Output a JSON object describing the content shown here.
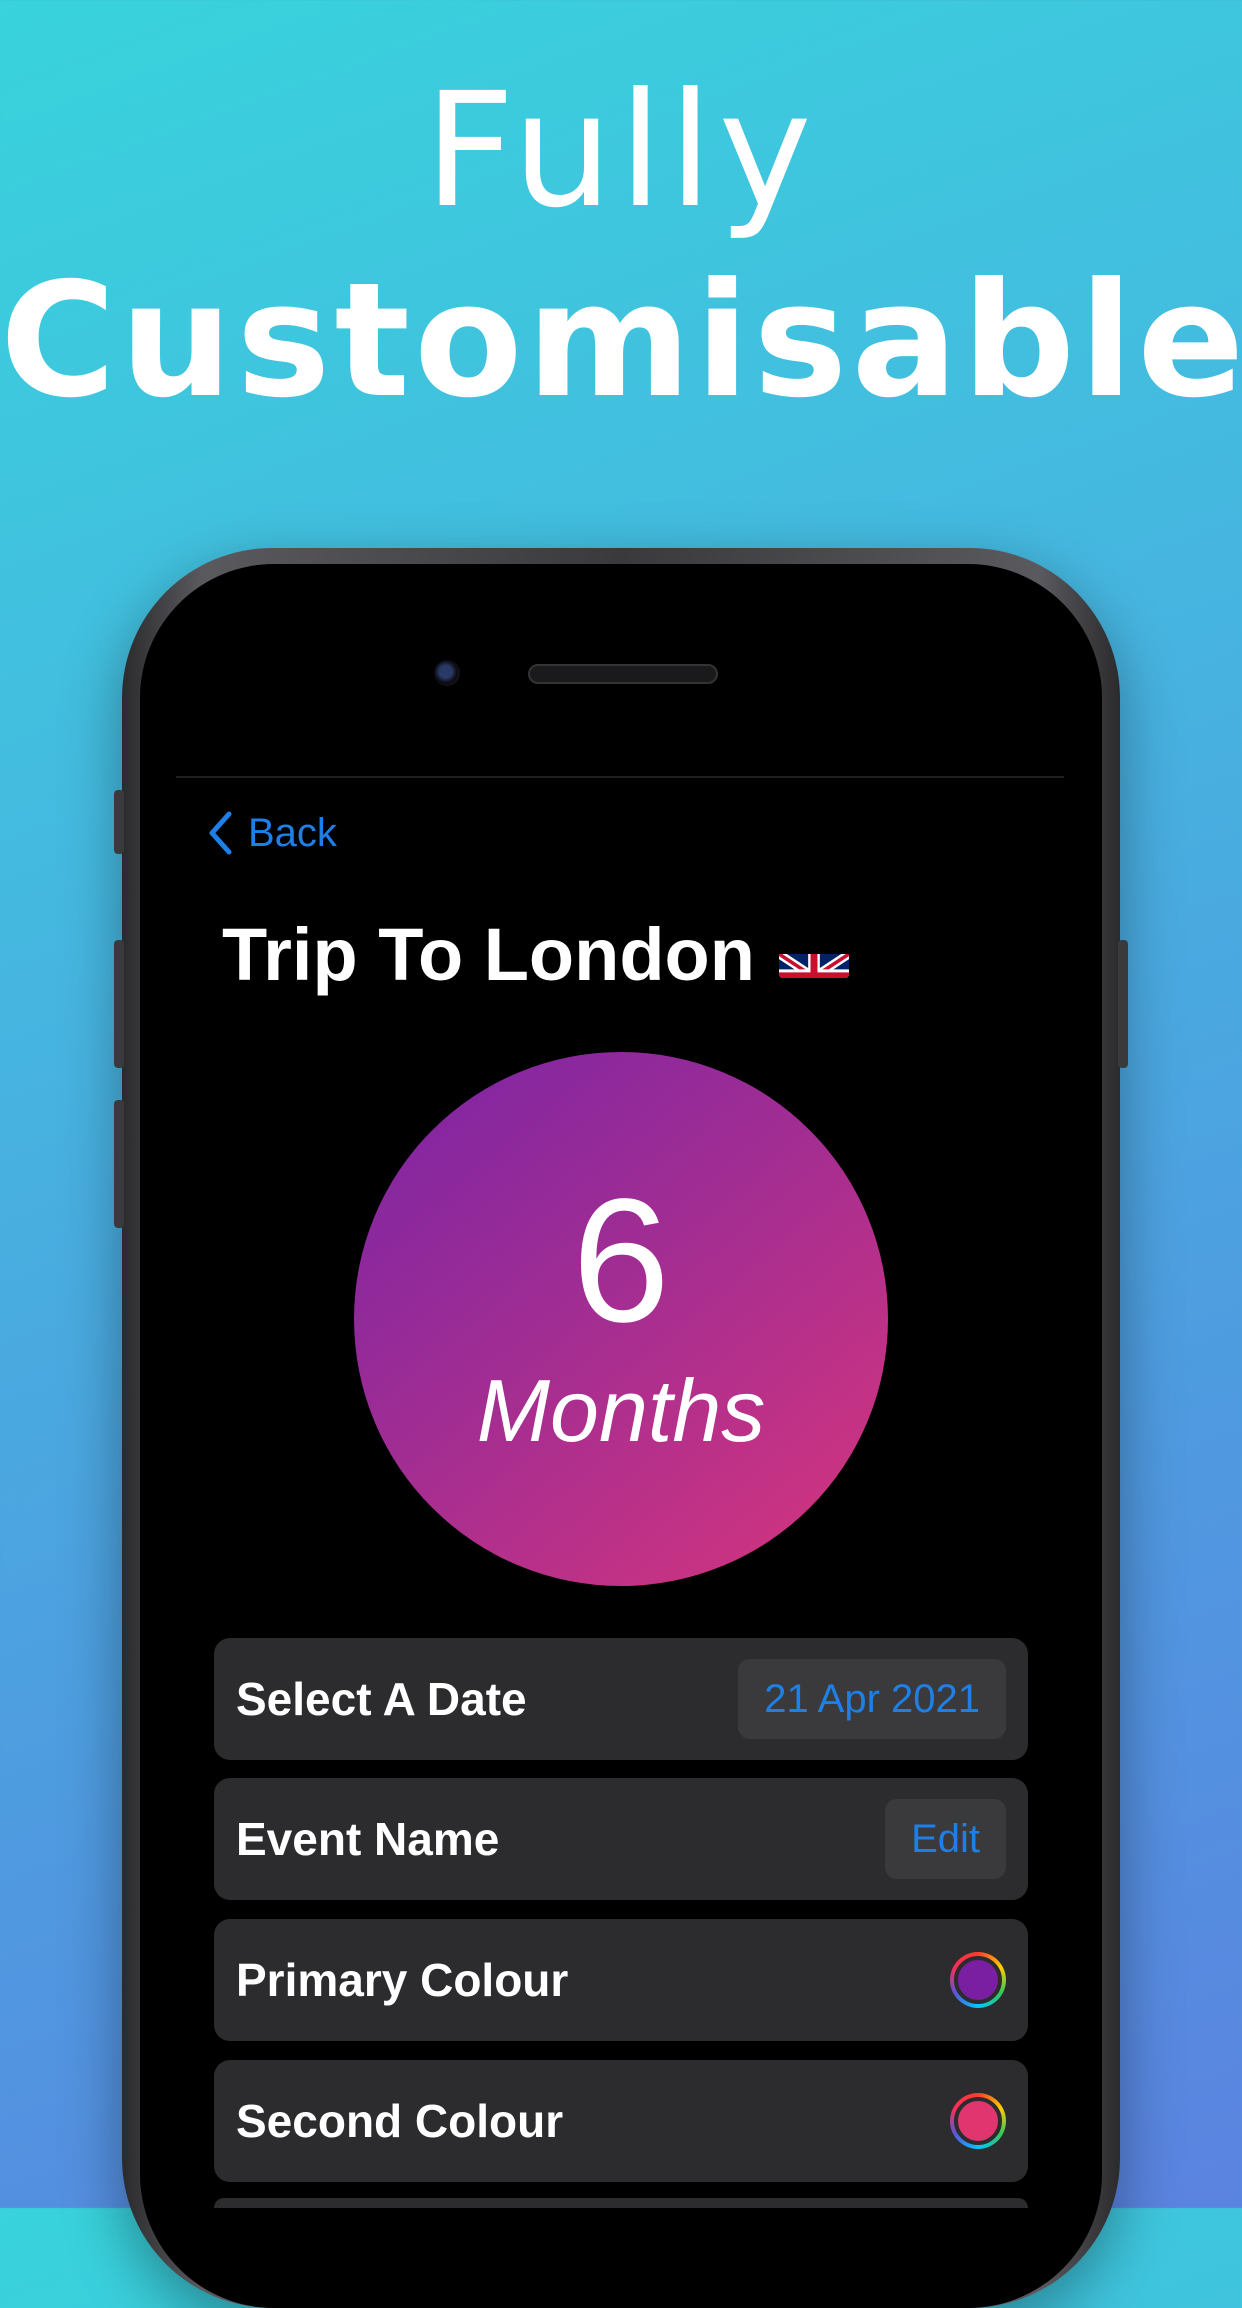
{
  "headline": {
    "line1": "Fully",
    "line2": "Customisable"
  },
  "nav": {
    "back_label": "Back"
  },
  "event": {
    "title": "Trip To London",
    "flag_icon": "uk-flag-icon"
  },
  "countdown": {
    "value": "6",
    "unit": "Months",
    "gradient_start": "#7a24a6",
    "gradient_end": "#d8357c"
  },
  "settings": {
    "date": {
      "label": "Select A Date",
      "value": "21 Apr 2021"
    },
    "name": {
      "label": "Event Name",
      "action": "Edit"
    },
    "primary": {
      "label": "Primary Colour",
      "color": "#7a1fa2"
    },
    "second": {
      "label": "Second Colour",
      "color": "#e0356f"
    }
  },
  "accent": "#1e7fe6"
}
